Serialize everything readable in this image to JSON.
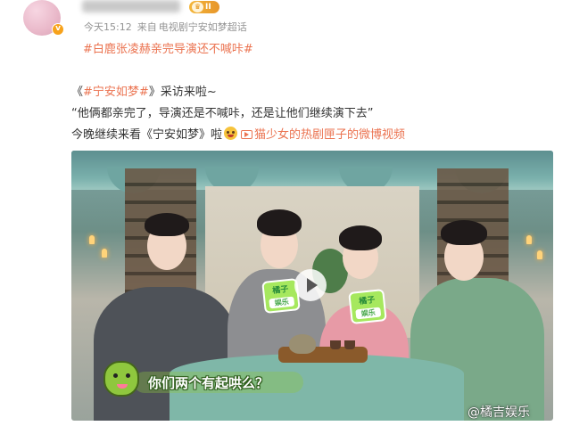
{
  "post": {
    "verified_badge": "v",
    "vip_badge": "II",
    "meta": {
      "time": "今天15:12",
      "source_prefix": "来自",
      "source": "电视剧宁安如梦超话"
    },
    "topic": "#白鹿张凌赫亲完导演还不喊咔#",
    "body": {
      "line1_open": "《",
      "line1_link": "#宁安如梦#",
      "line1_close": "》采访来啦~",
      "line2": "“他俩都亲完了，导演还是不喊咔，还是让他们继续演下去”",
      "line3_text": "今晚继续来看《宁安如梦》啦",
      "line3_link": "猫少女的热剧匣子的微博视频"
    }
  },
  "video": {
    "card_title": "橘子",
    "card_sub": "娱乐",
    "subtitle": "你们两个有起哄么？",
    "watermark": "@橘吉娱乐"
  },
  "colors": {
    "link": "#eb7350",
    "meta": "#939393",
    "text": "#333333",
    "mascot_green": "#8fc73e"
  },
  "icons": [
    "avatar",
    "verified-icon",
    "crown-icon",
    "video-link-icon",
    "emoji-icon",
    "play-icon",
    "mascot-icon"
  ]
}
